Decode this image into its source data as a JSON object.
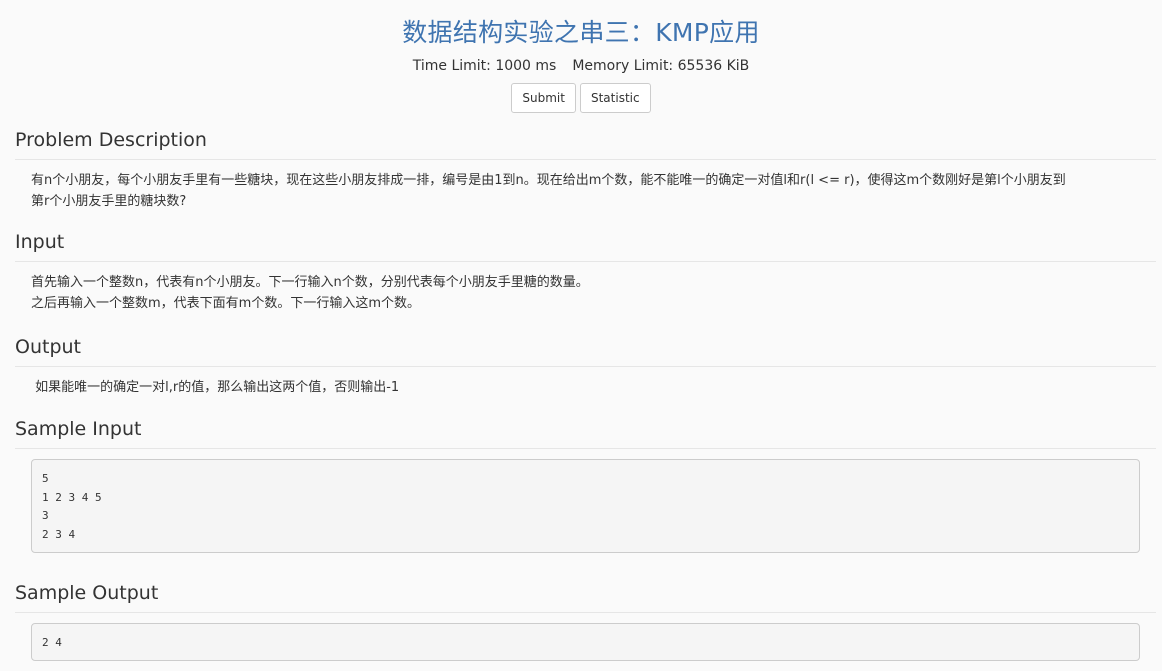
{
  "problem": {
    "title": "数据结构实验之串三：KMP应用",
    "time_limit": "Time Limit: 1000 ms",
    "memory_limit": "Memory Limit: 65536 KiB"
  },
  "actions": {
    "submit_label": "Submit",
    "statistic_label": "Statistic"
  },
  "sections": {
    "description": {
      "heading": "Problem Description",
      "lines": [
        "有n个小朋友，每个小朋友手里有一些糖块，现在这些小朋友排成一排，编号是由1到n。现在给出m个数，能不能唯一的确定一对值l和r(l <= r)，使得这m个数刚好是第l个小朋友到",
        "第r个小朋友手里的糖块数?"
      ]
    },
    "input": {
      "heading": "Input",
      "lines": [
        "首先输入一个整数n，代表有n个小朋友。下一行输入n个数，分别代表每个小朋友手里糖的数量。",
        "之后再输入一个整数m，代表下面有m个数。下一行输入这m个数。"
      ]
    },
    "output": {
      "heading": "Output",
      "lines": [
        " 如果能唯一的确定一对l,r的值，那么输出这两个值，否则输出-1"
      ]
    },
    "sample_input": {
      "heading": "Sample Input",
      "text": "5\n1 2 3 4 5\n3\n2 3 4"
    },
    "sample_output": {
      "heading": "Sample Output",
      "text": "2 4"
    }
  }
}
